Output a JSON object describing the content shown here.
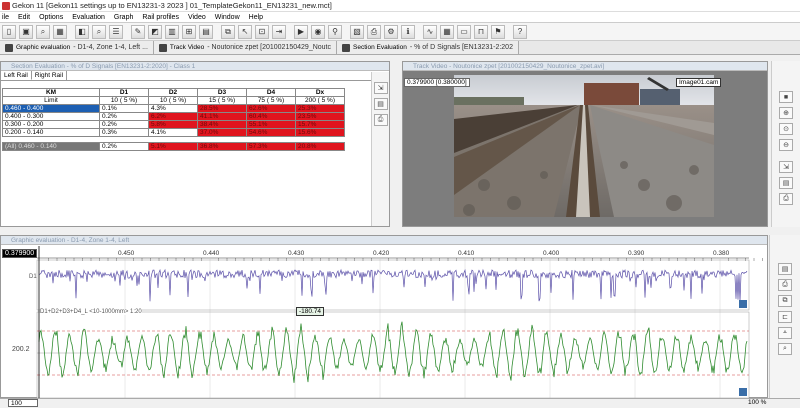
{
  "window": {
    "title": "Gekon 11 [Gekon11 settings up to EN13231-3 2023 ] 01_TemplateGekon11_EN13231_new.mct]"
  },
  "menu": [
    "ile",
    "Edit",
    "Options",
    "Evaluation",
    "Graph",
    "Rail profiles",
    "Video",
    "Window",
    "Help"
  ],
  "tabs": [
    {
      "label": "Graphic evaluation",
      "sub": "- D1-4, Zone 1-4, Left ..."
    },
    {
      "label": "Track Video",
      "sub": "- Noutonice zpet [201002150429_Noutc"
    },
    {
      "label": "Section Evaluation",
      "sub": "- % of D Signals [EN13231-2:202"
    }
  ],
  "section": {
    "title": "Section Evaluation - % of D Signals [EN13231-2:2020] - Class 1",
    "rail_tabs": [
      "Left Rail",
      "Right Rail"
    ],
    "headers": [
      "KM",
      "D1",
      "D2",
      "D3",
      "D4",
      "Dx"
    ],
    "limit_row": [
      "Limit",
      "10 ( 5 %)",
      "10 ( 5 %)",
      "15 ( 5 %)",
      "75 ( 5 %)",
      "200 ( 5 %)"
    ],
    "rows": [
      [
        "0.460 - 0.400",
        "0.1%",
        "4.3%",
        "28.5%",
        "62.6%",
        "25.3%"
      ],
      [
        "0.400 - 0.300",
        "0.2%",
        "6.2%",
        "41.1%",
        "60.4%",
        "23.5%"
      ],
      [
        "0.300 - 0.200",
        "0.2%",
        "5.8%",
        "38.4%",
        "55.1%",
        "15.7%"
      ],
      [
        "0.200 - 0.140",
        "0.3%",
        "4.1%",
        "37.0%",
        "54.6%",
        "15.6%"
      ]
    ],
    "total_row": [
      "(All) 0.460 - 0.140",
      "0.2%",
      "5.1%",
      "36.8%",
      "57.3%",
      "20.8%"
    ]
  },
  "video": {
    "title": "Track Video - Noutonice zpet [201002150429_Noutonice_zpet.avi]",
    "gauge": "0.379900 [0.380000]",
    "camera": "Image01.cam"
  },
  "graph": {
    "title": "Graphic evaluation - D1-4, Zone 1-4, Left",
    "position": "0.379900",
    "ticks": [
      "0.450",
      "0.440",
      "0.430",
      "0.420",
      "0.410",
      "0.400",
      "0.390",
      "0.380",
      "0.370"
    ],
    "channel2_label": "D1+D2+D3+D4_L <10-1000mm> 1:20",
    "value_box": "-180.74",
    "y_label": "200.2",
    "ch1_label": "D1"
  },
  "status": {
    "zoom_input": "100",
    "zoom_right": "100 %"
  },
  "colors": {
    "red": "#e0141e",
    "select": "#1d5fb2",
    "signal1": "#5a4fa8",
    "signal2": "#2e8b2e",
    "limit": "#d04040"
  }
}
